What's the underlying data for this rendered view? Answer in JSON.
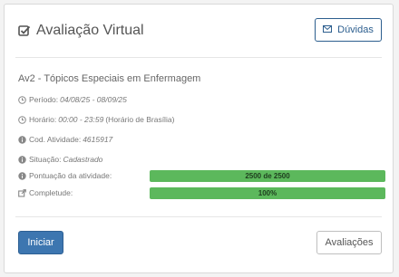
{
  "header": {
    "title": "Avaliação Virtual",
    "duvidas_label": "Dúvidas"
  },
  "course": {
    "name": "Av2 - Tópicos Especiais em Enfermagem"
  },
  "details": {
    "periodo_label": "Período:",
    "periodo_value": "04/08/25 - 08/09/25",
    "horario_label": "Horário:",
    "horario_value": "00:00 - 23:59",
    "horario_suffix": "(Horário de Brasília)",
    "cod_label": "Cod. Atividade:",
    "cod_value": "4615917",
    "situacao_label": "Situação:",
    "situacao_value": "Cadastrado",
    "pontuacao_label": "Pontuação da atividade:",
    "pontuacao_bar_text": "2500 de 2500",
    "pontuacao_fill_fraction": 1.0,
    "completude_label": "Completude:",
    "completude_bar_text": "100%",
    "completude_fill_fraction": 1.0
  },
  "footer": {
    "iniciar_label": "Iniciar",
    "avaliacoes_label": "Avaliações"
  },
  "colors": {
    "primary": "#3d76b0",
    "progress": "#5cb85c"
  }
}
